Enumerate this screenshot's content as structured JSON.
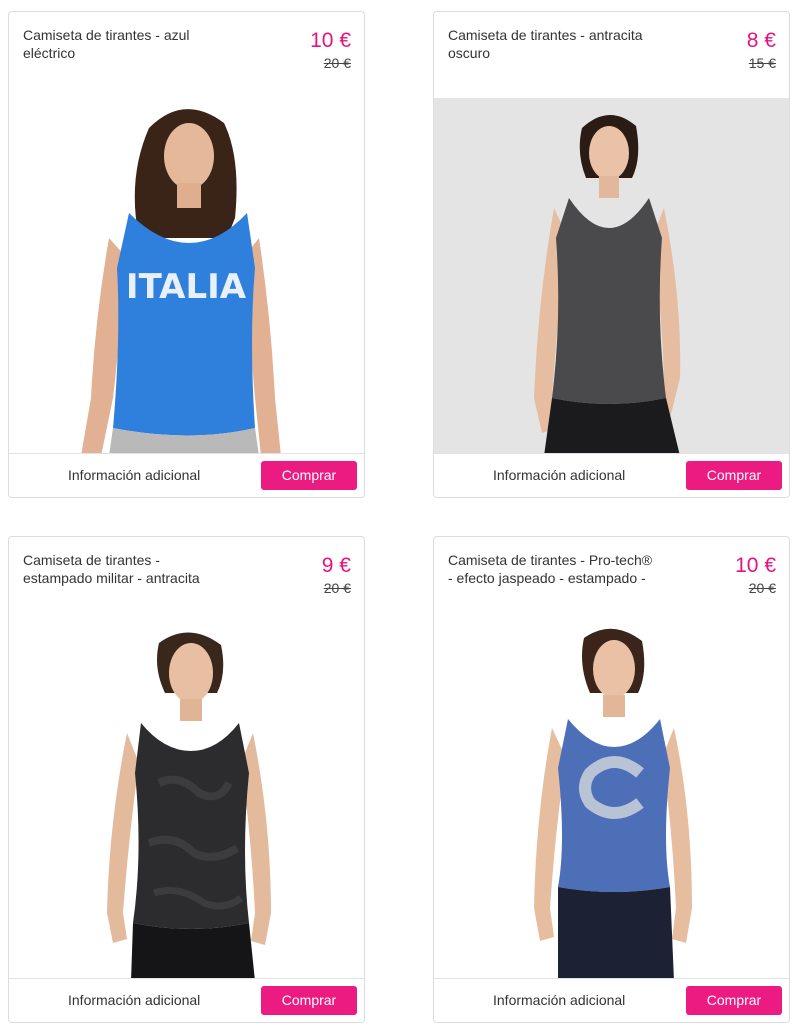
{
  "colors": {
    "accent": "#ec1b82",
    "price": "#e6137c",
    "border": "#dcdcdc"
  },
  "products": [
    {
      "title": "Camiseta de tirantes - azul eléctrico",
      "price": "10 €",
      "old_price": "20 €",
      "image_text": "ITALIA",
      "info_label": "Información adicional",
      "buy_label": "Comprar"
    },
    {
      "title": "Camiseta de tirantes - antracita oscuro",
      "price": "8 €",
      "old_price": "15 €",
      "info_label": "Información adicional",
      "buy_label": "Comprar"
    },
    {
      "title": "Camiseta de tirantes - estampado militar - antracita",
      "price": "9 €",
      "old_price": "20 €",
      "info_label": "Información adicional",
      "buy_label": "Comprar"
    },
    {
      "title": "Camiseta de tirantes - Pro-tech® - efecto jaspeado - estampado -",
      "price": "10 €",
      "old_price": "20 €",
      "info_label": "Información adicional",
      "buy_label": "Comprar"
    }
  ]
}
